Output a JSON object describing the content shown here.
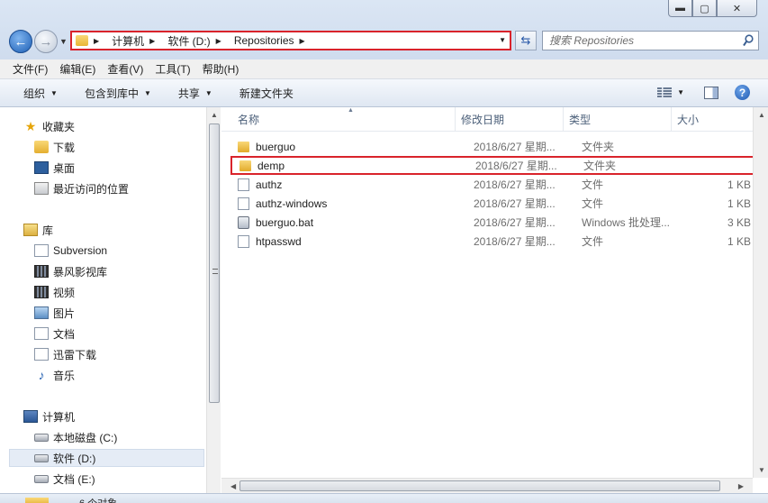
{
  "window": {
    "controls": {
      "minimize": "▬",
      "maximize": "▢",
      "close": "✕"
    }
  },
  "address": {
    "crumbs": [
      "计算机",
      "软件 (D:)",
      "Repositories"
    ],
    "search_placeholder": "搜索 Repositories"
  },
  "menu": [
    "文件(F)",
    "编辑(E)",
    "查看(V)",
    "工具(T)",
    "帮助(H)"
  ],
  "commands": {
    "organize": "组织",
    "include_library": "包含到库中",
    "share": "共享",
    "new_folder": "新建文件夹"
  },
  "nav": {
    "favorites": "收藏夹",
    "downloads": "下载",
    "desktop": "桌面",
    "recent": "最近访问的位置",
    "libraries": "库",
    "subversion": "Subversion",
    "baofeng": "暴风影视库",
    "videos": "视频",
    "pictures": "图片",
    "documents": "文档",
    "xunlei": "迅雷下载",
    "music": "音乐",
    "computer": "计算机",
    "drive_c": "本地磁盘 (C:)",
    "drive_d": "软件 (D:)",
    "drive_e": "文档 (E:)"
  },
  "columns": {
    "name": "名称",
    "date": "修改日期",
    "type": "类型",
    "size": "大小"
  },
  "files": [
    {
      "name": "buerguo",
      "date": "2018/6/27 星期...",
      "type": "文件夹",
      "size": ""
    },
    {
      "name": "demp",
      "date": "2018/6/27 星期...",
      "type": "文件夹",
      "size": ""
    },
    {
      "name": "authz",
      "date": "2018/6/27 星期...",
      "type": "文件",
      "size": "1 KB"
    },
    {
      "name": "authz-windows",
      "date": "2018/6/27 星期...",
      "type": "文件",
      "size": "1 KB"
    },
    {
      "name": "buerguo.bat",
      "date": "2018/6/27 星期...",
      "type": "Windows 批处理...",
      "size": "3 KB"
    },
    {
      "name": "htpasswd",
      "date": "2018/6/27 星期...",
      "type": "文件",
      "size": "1 KB"
    }
  ],
  "details": {
    "count": "6 个对象"
  },
  "colors": {
    "highlight": "#d9232b",
    "accent": "#1d5fb5"
  }
}
